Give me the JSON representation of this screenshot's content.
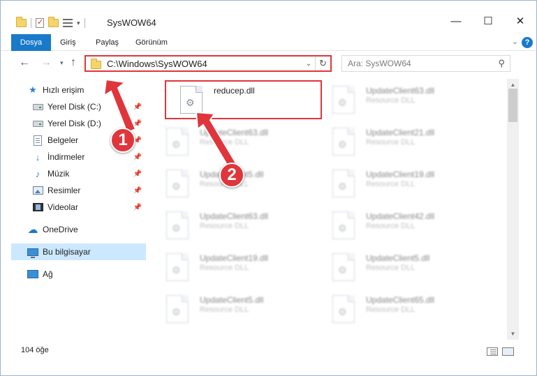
{
  "window": {
    "title": "SysWOW64",
    "controls": {
      "minimize": "—",
      "maximize": "☐",
      "close": "✕"
    }
  },
  "ribbon": {
    "tabs": [
      {
        "label": "Dosya",
        "active": true
      },
      {
        "label": "Giriş",
        "active": false
      },
      {
        "label": "Paylaş",
        "active": false
      },
      {
        "label": "Görünüm",
        "active": false
      }
    ],
    "help_label": "?"
  },
  "address": {
    "path": "C:\\Windows\\SysWOW64",
    "search_placeholder": "Ara: SysWOW64"
  },
  "sidebar": {
    "items": [
      {
        "label": "Hızlı erişim",
        "icon": "star-icon"
      },
      {
        "label": "Yerel Disk (C:)",
        "icon": "drive-icon",
        "pinned": true
      },
      {
        "label": "Yerel Disk (D:)",
        "icon": "drive-icon",
        "pinned": true
      },
      {
        "label": "Belgeler",
        "icon": "documents-icon",
        "pinned": true
      },
      {
        "label": "İndirmeler",
        "icon": "download-icon",
        "pinned": true
      },
      {
        "label": "Müzik",
        "icon": "music-icon",
        "pinned": true
      },
      {
        "label": "Resimler",
        "icon": "pictures-icon",
        "pinned": true
      },
      {
        "label": "Videolar",
        "icon": "videos-icon",
        "pinned": true
      },
      {
        "label": "OneDrive",
        "icon": "onedrive-icon"
      },
      {
        "label": "Bu bilgisayar",
        "icon": "this-pc-icon",
        "selected": true
      },
      {
        "label": "Ağ",
        "icon": "network-icon"
      }
    ]
  },
  "files": [
    {
      "name": "reducep.dll",
      "description": "",
      "highlighted": true
    },
    {
      "name": "UpdateClient63.dll",
      "description": "Resource DLL"
    },
    {
      "name": "UpdateClient63.dll",
      "description": "Resource DLL"
    },
    {
      "name": "UpdateClient21.dll",
      "description": "Resource DLL"
    },
    {
      "name": "UpdateClient5.dll",
      "description": "Resource DLL"
    },
    {
      "name": "UpdateClient19.dll",
      "description": "Resource DLL"
    },
    {
      "name": "UpdateClient63.dll",
      "description": "Resource DLL"
    },
    {
      "name": "UpdateClient42.dll",
      "description": "Resource DLL"
    },
    {
      "name": "UpdateClient19.dll",
      "description": "Resource DLL"
    },
    {
      "name": "UpdateClient5.dll",
      "description": "Resource DLL"
    },
    {
      "name": "UpdateClient5.dll",
      "description": "Resource DLL"
    },
    {
      "name": "UpdateClient65.dll",
      "description": "Resource DLL"
    }
  ],
  "status": {
    "item_count": "104 öğe"
  },
  "annotations": {
    "step1": "1",
    "step2": "2",
    "accent": "#e0353b"
  }
}
